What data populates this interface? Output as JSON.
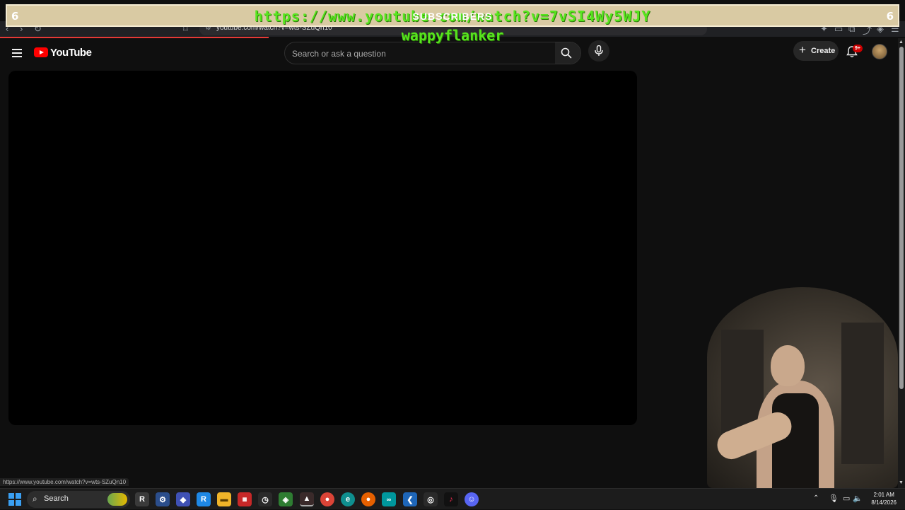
{
  "overlay": {
    "left_number": "6",
    "right_number": "6",
    "url_text": "https://www.youtube.com/watch?v=7vSI4Wy5WJY",
    "label": "SUBSCRIBERS",
    "username": "wappyflanker"
  },
  "browser": {
    "url": "youtube.com/watch?v=wts-SZuQn10",
    "status_link": "https://www.youtube.com/watch?v=wts-SZuQn10"
  },
  "youtube": {
    "logo_text": "YouTube",
    "search_placeholder": "Search or ask a question",
    "create_label": "Create",
    "notification_count": "9+"
  },
  "taskbar": {
    "search_label": "Search",
    "time": "2:01 AM",
    "date": "8/14/2026"
  },
  "colors": {
    "overlay_text": "#57e51e",
    "youtube_red": "#ff0000",
    "page_background": "#0f0f0f"
  }
}
